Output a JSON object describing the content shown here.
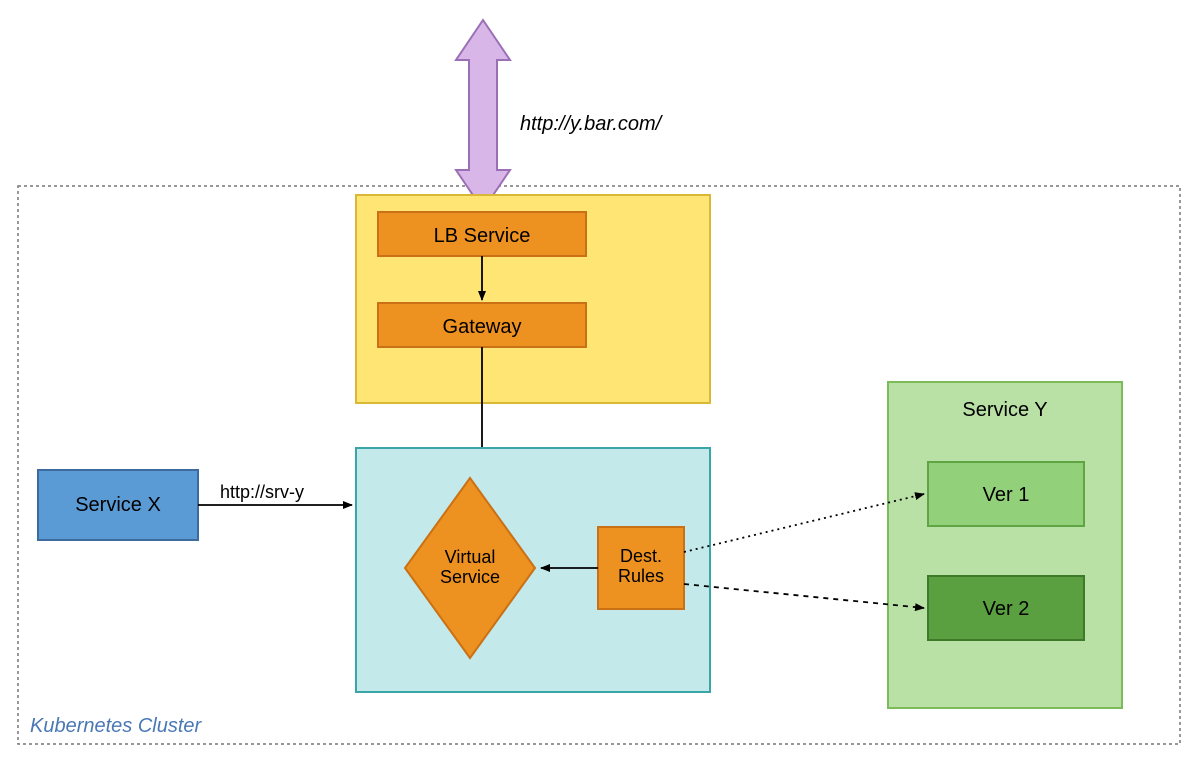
{
  "diagram": {
    "cluster_label": "Kubernetes Cluster",
    "external_url": "http://y.bar.com/",
    "internal_url": "http://srv-y",
    "yellow_box": {
      "lb_service": "LB Service",
      "gateway": "Gateway"
    },
    "teal_box": {
      "virtual_service_l1": "Virtual",
      "virtual_service_l2": "Service",
      "dest_rules_l1": "Dest.",
      "dest_rules_l2": "Rules"
    },
    "service_x": "Service X",
    "service_y": {
      "title": "Service Y",
      "ver1": "Ver 1",
      "ver2": "Ver 2"
    },
    "colors": {
      "yellow_fill": "#ffe574",
      "orange_fill": "#ed9121",
      "orange_stroke": "#c97114",
      "teal_fill": "#c3e9ea",
      "teal_stroke": "#3aa5a7",
      "blue_fill": "#5b9bd5",
      "blue_stroke": "#3d6b9e",
      "lightgreen_fill": "#b9e0a5",
      "lightgreen_stroke": "#7bbb5a",
      "midgreen_fill": "#93d07a",
      "midgreen_stroke": "#5fa544",
      "darkgreen_fill": "#5aa040",
      "darkgreen_stroke": "#3f7a2b",
      "arrow_purple": "#d8b7e8",
      "arrow_purple_stroke": "#9b6fb5"
    }
  }
}
